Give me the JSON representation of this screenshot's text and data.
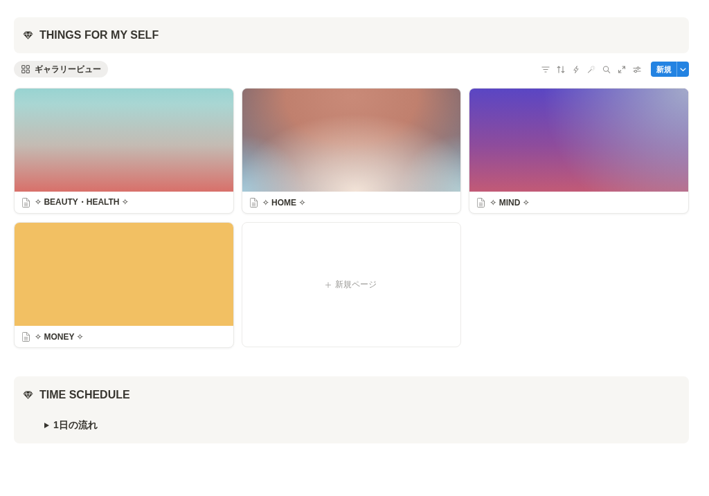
{
  "header": {
    "title": "THINGS FOR MY SELF"
  },
  "view_tabs": [
    {
      "label": "ギャラリービュー",
      "selected": true
    }
  ],
  "new_button": {
    "label": "新規"
  },
  "cards": [
    {
      "title": "✧ BEAUTY・HEALTH ✧"
    },
    {
      "title": "✧ HOME ✧"
    },
    {
      "title": "✧ MIND ✧"
    },
    {
      "title": "✧ MONEY ✧"
    }
  ],
  "new_page": {
    "label": "新規ページ"
  },
  "schedule": {
    "title": "TIME SCHEDULE",
    "toggles": [
      {
        "label": "1日の流れ",
        "expanded": false
      }
    ]
  }
}
